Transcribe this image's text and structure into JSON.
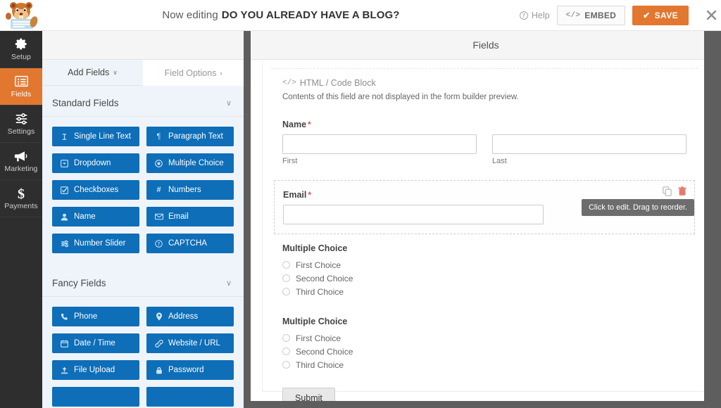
{
  "header": {
    "logo_icon": "wpforms-beaver-logo",
    "editing_prefix": "Now editing",
    "form_title": "DO YOU ALREADY HAVE A BLOG?",
    "help_label": "Help",
    "help_icon": "question-circle-icon",
    "embed_label": "EMBED",
    "embed_icon": "code-brackets-icon",
    "save_label": "SAVE",
    "save_icon": "check-icon",
    "close_icon": "close-x-icon",
    "save_color": "#e27730"
  },
  "leftnav": {
    "items": [
      {
        "label": "Setup",
        "icon": "gear-icon",
        "active": false
      },
      {
        "label": "Fields",
        "icon": "fields-list-icon",
        "active": true
      },
      {
        "label": "Settings",
        "icon": "sliders-icon",
        "active": false
      },
      {
        "label": "Marketing",
        "icon": "megaphone-icon",
        "active": false
      },
      {
        "label": "Payments",
        "icon": "dollar-sign-icon",
        "active": false
      }
    ],
    "active_color": "#e27730",
    "background": "#2e2e2e"
  },
  "panel": {
    "tabs": {
      "add_fields": "Add Fields",
      "add_fields_caret": "∨",
      "field_options": "Field Options",
      "field_options_caret": "›"
    },
    "sections": [
      {
        "title": "Standard Fields",
        "caret": "∨",
        "buttons": [
          {
            "label": "Single Line Text",
            "icon": "text-cursor-icon"
          },
          {
            "label": "Paragraph Text",
            "icon": "paragraph-icon"
          },
          {
            "label": "Dropdown",
            "icon": "dropdown-icon"
          },
          {
            "label": "Multiple Choice",
            "icon": "radio-icon"
          },
          {
            "label": "Checkboxes",
            "icon": "checkbox-icon"
          },
          {
            "label": "Numbers",
            "icon": "hash-icon"
          },
          {
            "label": "Name",
            "icon": "user-icon"
          },
          {
            "label": "Email",
            "icon": "envelope-icon"
          },
          {
            "label": "Number Slider",
            "icon": "slider-icon"
          },
          {
            "label": "CAPTCHA",
            "icon": "captcha-icon"
          }
        ]
      },
      {
        "title": "Fancy Fields",
        "caret": "∨",
        "buttons": [
          {
            "label": "Phone",
            "icon": "phone-icon"
          },
          {
            "label": "Address",
            "icon": "map-pin-icon"
          },
          {
            "label": "Date / Time",
            "icon": "calendar-icon"
          },
          {
            "label": "Website / URL",
            "icon": "link-icon"
          },
          {
            "label": "File Upload",
            "icon": "upload-icon"
          },
          {
            "label": "Password",
            "icon": "lock-icon"
          }
        ]
      }
    ],
    "button_color": "#0e6eb8",
    "background": "#eef4f9"
  },
  "preview": {
    "subheader_title": "Fields",
    "fields": [
      {
        "type": "html-code-block",
        "label": "HTML / Code Block",
        "icon": "code-brackets-icon",
        "note": "Contents of this field are not displayed in the form builder preview."
      },
      {
        "type": "name",
        "label": "Name",
        "required": true,
        "required_mark": "*",
        "sublabels": [
          "First",
          "Last"
        ]
      },
      {
        "type": "email",
        "label": "Email",
        "required": true,
        "required_mark": "*",
        "hovered": true,
        "duplicate_icon": "duplicate-icon",
        "delete_icon": "trash-icon",
        "tooltip": "Click to edit. Drag to reorder."
      },
      {
        "type": "radio",
        "label": "Multiple Choice",
        "required": false,
        "choices": [
          "First Choice",
          "Second Choice",
          "Third Choice"
        ]
      },
      {
        "type": "radio",
        "label": "Multiple Choice",
        "required": false,
        "choices": [
          "First Choice",
          "Second Choice",
          "Third Choice"
        ]
      }
    ],
    "submit_label": "Submit"
  }
}
